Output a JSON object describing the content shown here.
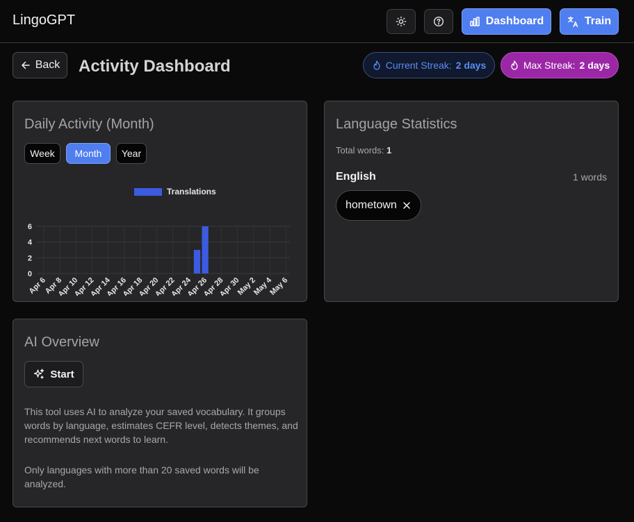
{
  "app": {
    "title": "LingoGPT"
  },
  "header": {
    "theme_icon": "sun-icon",
    "help_icon": "help-circle-icon",
    "dashboard_label": "Dashboard",
    "train_label": "Train",
    "accent_color": "#4f7ef0"
  },
  "toolbar": {
    "back_label": "Back",
    "page_title": "Activity Dashboard",
    "current_streak_label": "Current Streak:",
    "current_streak_value": "2 days",
    "max_streak_label": "Max Streak:",
    "max_streak_value": "2 days",
    "max_streak_color": "#9b27a6"
  },
  "activity": {
    "title": "Daily Activity (Month)",
    "ranges": [
      "Week",
      "Month",
      "Year"
    ],
    "selected_range": "Month"
  },
  "chart_data": {
    "type": "bar",
    "legend": "Translations",
    "legend_placement": "top-center",
    "grid": true,
    "ylim": [
      0,
      6
    ],
    "yticks": [
      0,
      2,
      4,
      6
    ],
    "xticks": [
      "Apr 6",
      "Apr 8",
      "Apr 10",
      "Apr 12",
      "Apr 14",
      "Apr 16",
      "Apr 18",
      "Apr 20",
      "Apr 22",
      "Apr 24",
      "Apr 26",
      "Apr 28",
      "Apr 30",
      "May 2",
      "May 4",
      "May 6"
    ],
    "categories": [
      "Apr 6",
      "Apr 7",
      "Apr 8",
      "Apr 9",
      "Apr 10",
      "Apr 11",
      "Apr 12",
      "Apr 13",
      "Apr 14",
      "Apr 15",
      "Apr 16",
      "Apr 17",
      "Apr 18",
      "Apr 19",
      "Apr 20",
      "Apr 21",
      "Apr 22",
      "Apr 23",
      "Apr 24",
      "Apr 25",
      "Apr 26",
      "Apr 27",
      "Apr 28",
      "Apr 29",
      "Apr 30",
      "May 1",
      "May 2",
      "May 3",
      "May 4",
      "May 5",
      "May 6"
    ],
    "values": [
      0,
      0,
      0,
      0,
      0,
      0,
      0,
      0,
      0,
      0,
      0,
      0,
      0,
      0,
      0,
      0,
      0,
      0,
      0,
      3,
      6,
      0,
      0,
      0,
      0,
      0,
      0,
      0,
      0,
      0,
      0
    ],
    "color": "#3c5be0"
  },
  "languages": {
    "title": "Language Statistics",
    "total_label": "Total words:",
    "total_value": "1",
    "items": [
      {
        "name": "English",
        "count_label": "1 words",
        "words": [
          "hometown"
        ]
      }
    ]
  },
  "ai_overview": {
    "title": "AI Overview",
    "start_label": "Start",
    "description": "This tool uses AI to analyze your saved vocabulary. It groups words by language, estimates CEFR level, detects themes, and recommends next words to learn.",
    "note": "Only languages with more than 20 saved words will be analyzed."
  }
}
